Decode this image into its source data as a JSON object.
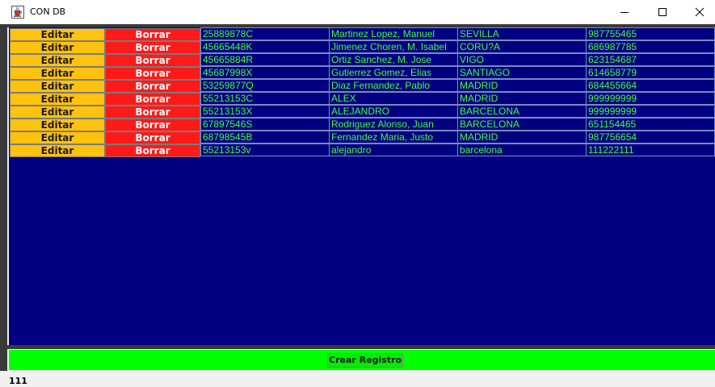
{
  "window": {
    "title": "CON DB",
    "icon": "java-cup-icon"
  },
  "table": {
    "edit_label": "Editar",
    "delete_label": "Borrar",
    "rows": [
      {
        "dni": "25889878C",
        "nombre": "Martinez  Lopez, Manuel",
        "ciudad": "SEVILLA",
        "telefono": "987755465"
      },
      {
        "dni": "45665448K",
        "nombre": "Jimenez Choren, M. Isabel",
        "ciudad": "CORU?A",
        "telefono": "686987785"
      },
      {
        "dni": "45665884R",
        "nombre": "Ortiz Sanchez, M. Jose",
        "ciudad": "VIGO",
        "telefono": "623154687"
      },
      {
        "dni": "45687998X",
        "nombre": "Gutierrez Gomez, Elias",
        "ciudad": "SANTIAGO",
        "telefono": "614658779"
      },
      {
        "dni": "53259877Q",
        "nombre": "Diaz Fernandez, Pablo",
        "ciudad": "MADRID",
        "telefono": "684455664"
      },
      {
        "dni": "55213153C",
        "nombre": "ALEX",
        "ciudad": "MADRID",
        "telefono": "999999999"
      },
      {
        "dni": "55213153X",
        "nombre": "ALEJANDRO",
        "ciudad": "BARCELONA",
        "telefono": "999999999"
      },
      {
        "dni": "67897546S",
        "nombre": "Rodriguez Alonso, Juan",
        "ciudad": "BARCELONA",
        "telefono": "651154465"
      },
      {
        "dni": "68798545B",
        "nombre": "Fernandez Maria, Justo",
        "ciudad": "MADRID",
        "telefono": "987756654"
      },
      {
        "dni": "55213153v",
        "nombre": "alejandro",
        "ciudad": "barcelona",
        "telefono": "111222111"
      }
    ]
  },
  "footer": {
    "create_label": "Crear Registro",
    "status": "111"
  },
  "colors": {
    "panel_bg": "#000080",
    "text_green": "#3cff3c",
    "edit_bg": "#ffc20e",
    "delete_bg": "#ff1a1a",
    "create_bar_bg": "#00ff00"
  }
}
